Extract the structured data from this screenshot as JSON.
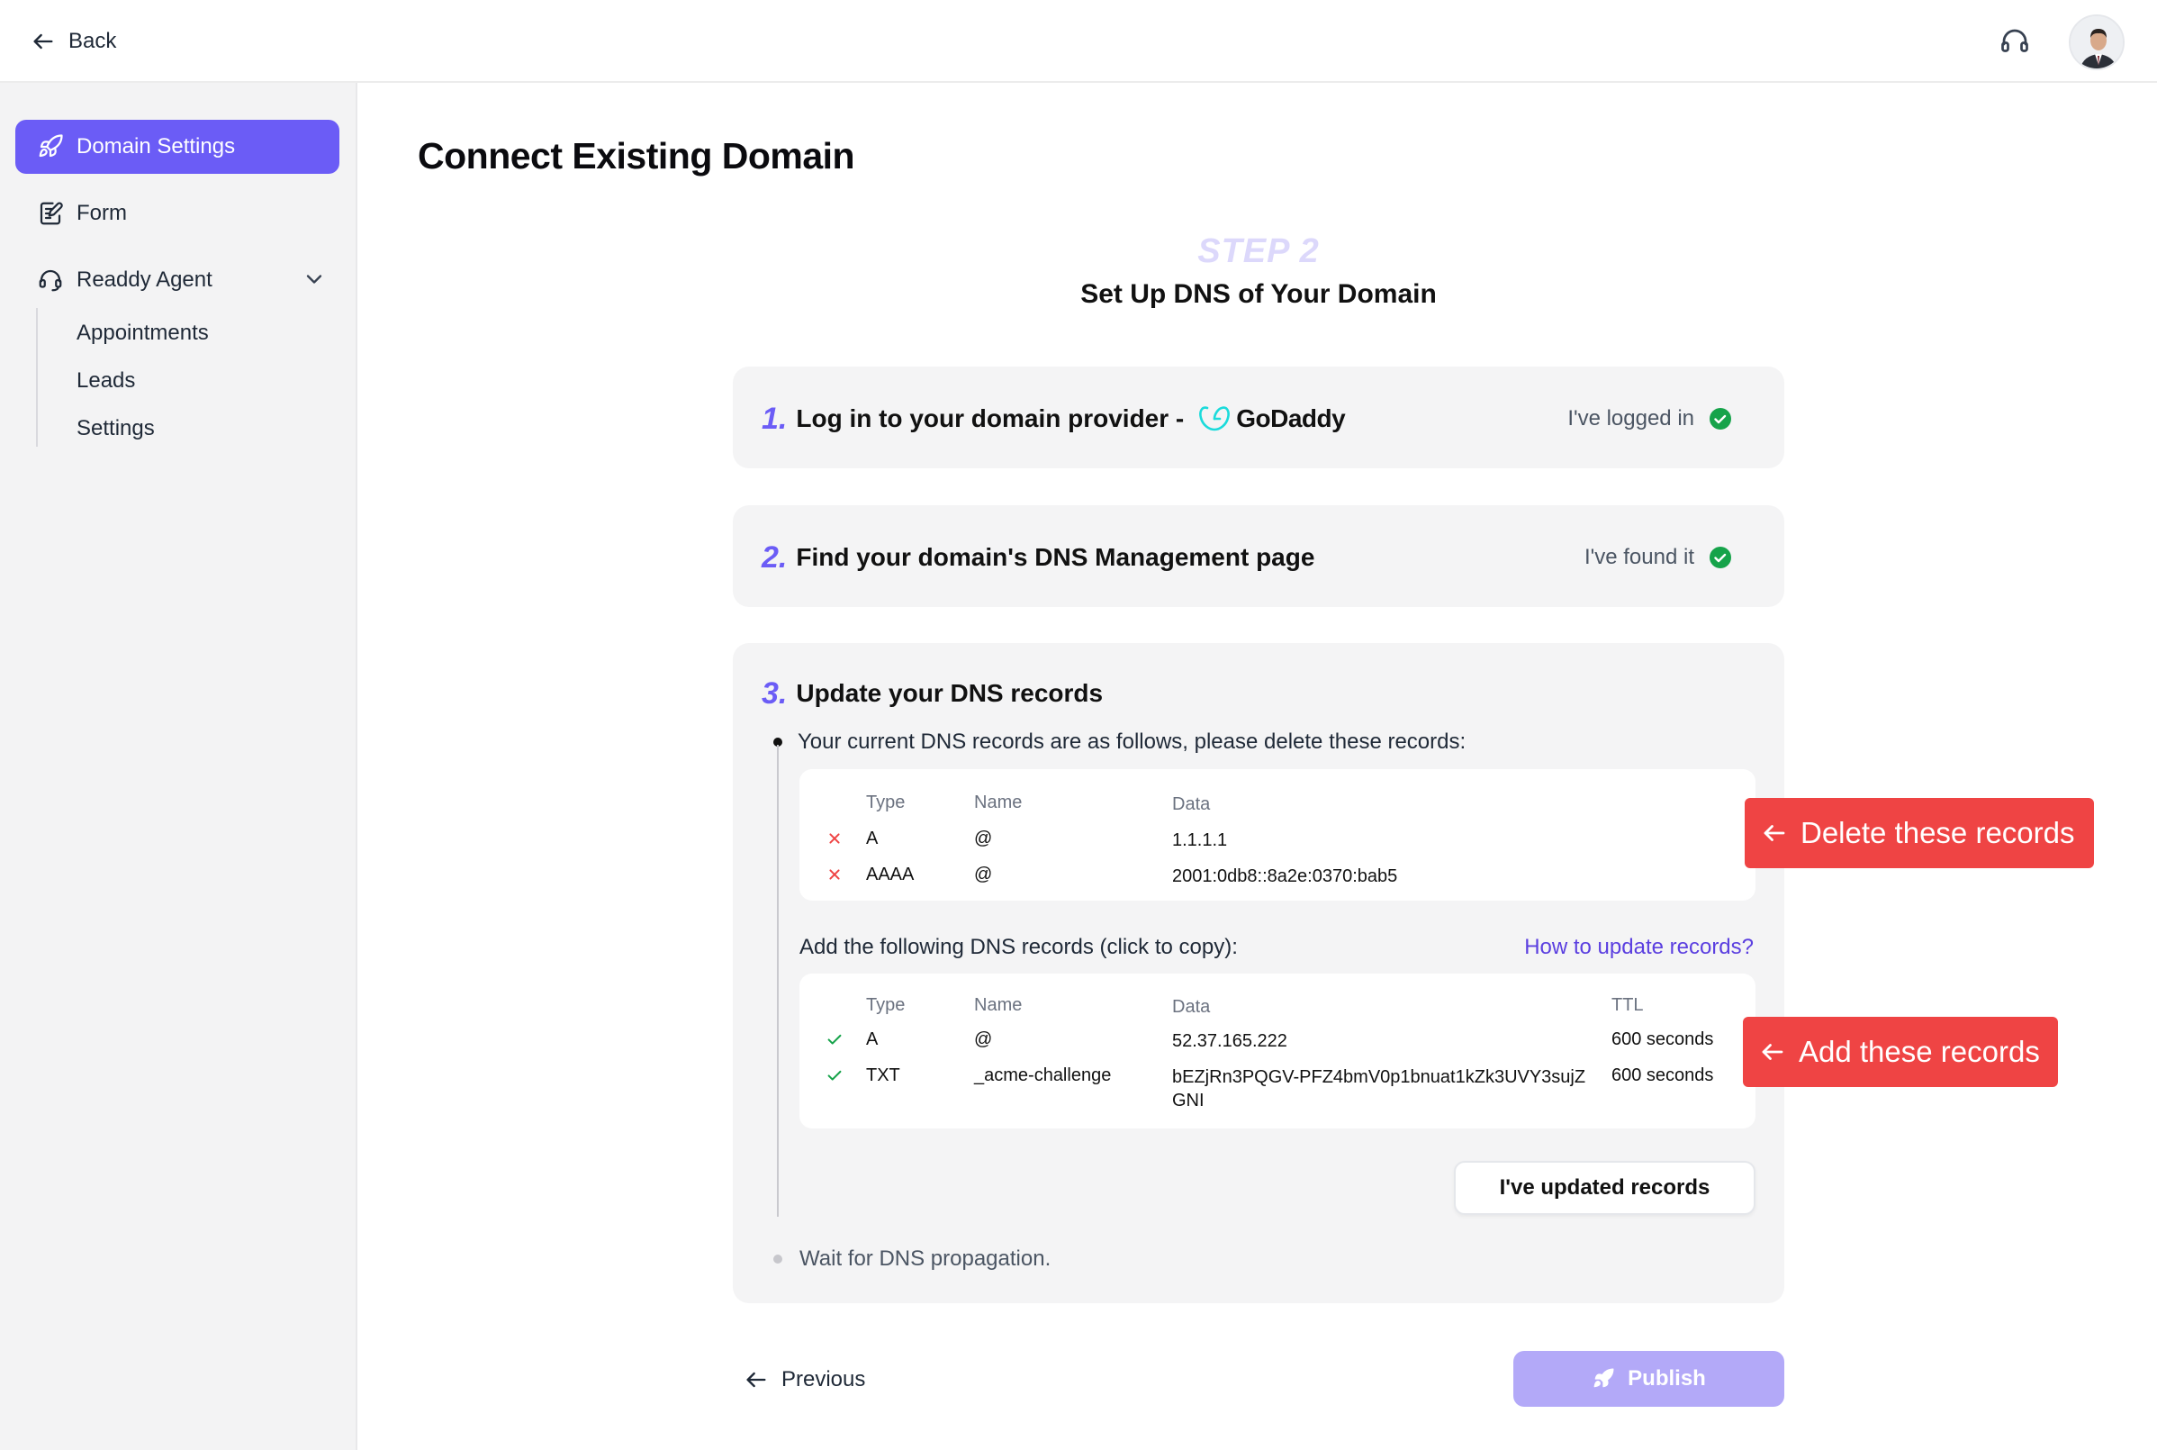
{
  "header": {
    "back_label": "Back",
    "support_icon": "headset-icon",
    "avatar_icon": "user-avatar"
  },
  "sidebar": {
    "items": [
      {
        "label": "Domain Settings",
        "icon": "rocket-icon",
        "active": true
      },
      {
        "label": "Form",
        "icon": "form-edit-icon"
      },
      {
        "label": "Readdy Agent",
        "icon": "agent-headset-icon",
        "expanded": true
      }
    ],
    "subitems": [
      {
        "label": "Appointments"
      },
      {
        "label": "Leads"
      },
      {
        "label": "Settings"
      }
    ]
  },
  "main": {
    "title": "Connect Existing Domain",
    "step_label": "STEP 2",
    "step_title": "Set Up DNS of Your Domain",
    "steps": [
      {
        "num": "1.",
        "title": "Log in to your domain provider -",
        "provider": "GoDaddy",
        "confirm": "I've logged in"
      },
      {
        "num": "2.",
        "title": "Find your domain's DNS Management page",
        "confirm": "I've found it"
      },
      {
        "num": "3.",
        "title": "Update your DNS records"
      }
    ],
    "delete_intro": "Your current DNS records are as follows, please delete these records:",
    "delete_table": {
      "headers": {
        "type": "Type",
        "name": "Name",
        "data": "Data"
      },
      "rows": [
        {
          "type": "A",
          "name": "@",
          "data": "1.1.1.1"
        },
        {
          "type": "AAAA",
          "name": "@",
          "data": "2001:0db8::8a2e:0370:bab5"
        }
      ]
    },
    "add_intro": "Add the following DNS records (click to copy):",
    "how_link": "How to update records?",
    "add_table": {
      "headers": {
        "type": "Type",
        "name": "Name",
        "data": "Data",
        "ttl": "TTL"
      },
      "rows": [
        {
          "type": "A",
          "name": "@",
          "data": "52.37.165.222",
          "ttl": "600 seconds"
        },
        {
          "type": "TXT",
          "name": "_acme-challenge",
          "data": "bEZjRn3PQGV-PFZ4bmV0p1bnuat1kZk3UVY3sujZGNI",
          "ttl": "600 seconds"
        }
      ]
    },
    "updated_button": "I've updated records",
    "wait_text": "Wait for DNS propagation.",
    "previous_label": "Previous",
    "publish_label": "Publish"
  },
  "callouts": {
    "delete": "Delete these records",
    "add": "Add these records"
  },
  "colors": {
    "accent": "#6b5cf6",
    "success": "#16a34a",
    "danger": "#ef4444",
    "publish_disabled": "#b3a9f8"
  }
}
